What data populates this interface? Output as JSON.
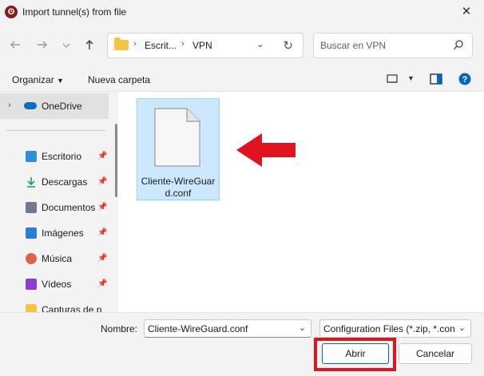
{
  "window": {
    "title": "Import tunnel(s) from file",
    "app_icon": "wireguard-logo"
  },
  "nav": {
    "back_icon": "arrow-left-icon",
    "forward_icon": "arrow-right-icon",
    "recent_icon": "chevron-down-icon",
    "up_icon": "arrow-up-icon"
  },
  "address": {
    "crumbs": [
      "Escrit...",
      "VPN"
    ]
  },
  "search": {
    "placeholder": "Buscar en VPN"
  },
  "toolbar": {
    "organize": "Organizar",
    "new_folder": "Nueva carpeta"
  },
  "nav_pane": {
    "onedrive": "OneDrive",
    "items": [
      {
        "label": "Escritorio",
        "icon": "desktop-icon",
        "color": "#2f8fd8"
      },
      {
        "label": "Descargas",
        "icon": "download-icon",
        "color": "#1a9e5a"
      },
      {
        "label": "Documentos",
        "icon": "documents-icon",
        "color": "#6d7a89"
      },
      {
        "label": "Imágenes",
        "icon": "pictures-icon",
        "color": "#2a7fd4"
      },
      {
        "label": "Música",
        "icon": "music-icon",
        "color": "#e0634b"
      },
      {
        "label": "Vídeos",
        "icon": "videos-icon",
        "color": "#8a3fd1"
      },
      {
        "label": "Capturas de p",
        "icon": "folder-icon",
        "color": "#f5c542"
      }
    ]
  },
  "files": [
    {
      "name": "Cliente-WireGuard.conf",
      "selected": true
    }
  ],
  "footer": {
    "name_label": "Nombre:",
    "name_value": "Cliente-WireGuard.conf",
    "filetype": "Configuration Files (*.zip, *.conf)",
    "open": "Abrir",
    "cancel": "Cancelar"
  },
  "colors": {
    "accent": "#0067c0",
    "highlight": "#e0141e",
    "selection": "#cce8ff"
  }
}
